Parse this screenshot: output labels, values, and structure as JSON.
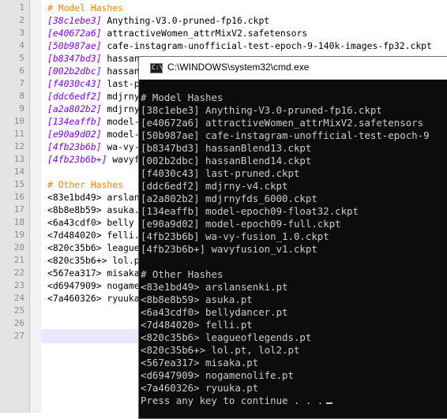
{
  "editor": {
    "line_numbers": [
      "1",
      "2",
      "3",
      "4",
      "5",
      "6",
      "7",
      "8",
      "9",
      "10",
      "11",
      "12",
      "13",
      "14",
      "15",
      "16",
      "17",
      "18",
      "19",
      "20",
      "21",
      "22",
      "23",
      "24",
      "25",
      "26",
      "27"
    ],
    "lines": [
      {
        "hash": "",
        "text": "# Model Hashes",
        "kind": "comment"
      },
      {
        "hash": "[38c1ebe3]",
        "text": " Anything-V3.0-pruned-fp16.ckpt",
        "kind": "model"
      },
      {
        "hash": "[e40672a6]",
        "text": " attractiveWomen_attrMixV2.safetensors",
        "kind": "model"
      },
      {
        "hash": "[50b987ae]",
        "text": " cafe-instagram-unofficial-test-epoch-9-140k-images-fp32.ckpt",
        "kind": "model"
      },
      {
        "hash": "[b8347bd3]",
        "text": " hassan",
        "kind": "model"
      },
      {
        "hash": "[002b2dbc]",
        "text": " hassan",
        "kind": "model"
      },
      {
        "hash": "[f4030c43]",
        "text": " last-p",
        "kind": "model"
      },
      {
        "hash": "[ddc6edf2]",
        "text": " mdjrny",
        "kind": "model"
      },
      {
        "hash": "[a2a802b2]",
        "text": " mdjrny",
        "kind": "model"
      },
      {
        "hash": "[134eaffb]",
        "text": " model-",
        "kind": "model"
      },
      {
        "hash": "[e90a9d02]",
        "text": " model-",
        "kind": "model"
      },
      {
        "hash": "[4fb23b6b]",
        "text": " wa-vy-",
        "kind": "model"
      },
      {
        "hash": "[4fb23b6b+]",
        "text": " wavyf",
        "kind": "model"
      },
      {
        "hash": "",
        "text": "",
        "kind": "blank"
      },
      {
        "hash": "",
        "text": "# Other Hashes",
        "kind": "comment"
      },
      {
        "hash": "<83e1bd49>",
        "text": " arslan",
        "kind": "other"
      },
      {
        "hash": "<8b8e8b59>",
        "text": " asuka.",
        "kind": "other"
      },
      {
        "hash": "<6a43cdf0>",
        "text": " belly",
        "kind": "other"
      },
      {
        "hash": "<7d484020>",
        "text": " felli.",
        "kind": "other"
      },
      {
        "hash": "<820c35b6>",
        "text": " league",
        "kind": "other"
      },
      {
        "hash": "<820c35b6+>",
        "text": " lol.p",
        "kind": "other"
      },
      {
        "hash": "<567ea317>",
        "text": " misaka",
        "kind": "other"
      },
      {
        "hash": "<d6947909>",
        "text": " nogame",
        "kind": "other"
      },
      {
        "hash": "<7a460326>",
        "text": " ryuuka",
        "kind": "other"
      },
      {
        "hash": "",
        "text": "",
        "kind": "blank"
      },
      {
        "hash": "",
        "text": "",
        "kind": "blank"
      },
      {
        "hash": "",
        "text": "",
        "kind": "blank"
      }
    ]
  },
  "cmd": {
    "title": "C:\\WINDOWS\\system32\\cmd.exe",
    "icon": "cmd-icon",
    "lines": [
      "",
      "# Model Hashes",
      "[38c1ebe3] Anything-V3.0-pruned-fp16.ckpt",
      "[e40672a6] attractiveWomen_attrMixV2.safetensors",
      "[50b987ae] cafe-instagram-unofficial-test-epoch-9",
      "[b8347bd3] hassanBlend13.ckpt",
      "[002b2dbc] hassanBlend14.ckpt",
      "[f4030c43] last-pruned.ckpt",
      "[ddc6edf2] mdjrny-v4.ckpt",
      "[a2a802b2] mdjrnyfds_6000.ckpt",
      "[134eaffb] model-epoch09-float32.ckpt",
      "[e90a9d02] model-epoch09-full.ckpt",
      "[4fb23b6b] wa-vy-fusion_1.0.ckpt",
      "[4fb23b6b+] wavyfusion_v1.ckpt",
      "",
      "# Other Hashes",
      "<83e1bd49> arslansenki.pt",
      "<8b8e8b59> asuka.pt",
      "<6a43cdf0> bellydancer.pt",
      "<7d484020> felli.pt",
      "<820c35b6> leagueoflegends.pt",
      "<820c35b6+> lol.pt, lol2.pt",
      "<567ea317> misaka.pt",
      "<d6947909> nogamenolife.pt",
      "<7a460326> ryuuka.pt",
      "Press any key to continue . . ."
    ]
  }
}
